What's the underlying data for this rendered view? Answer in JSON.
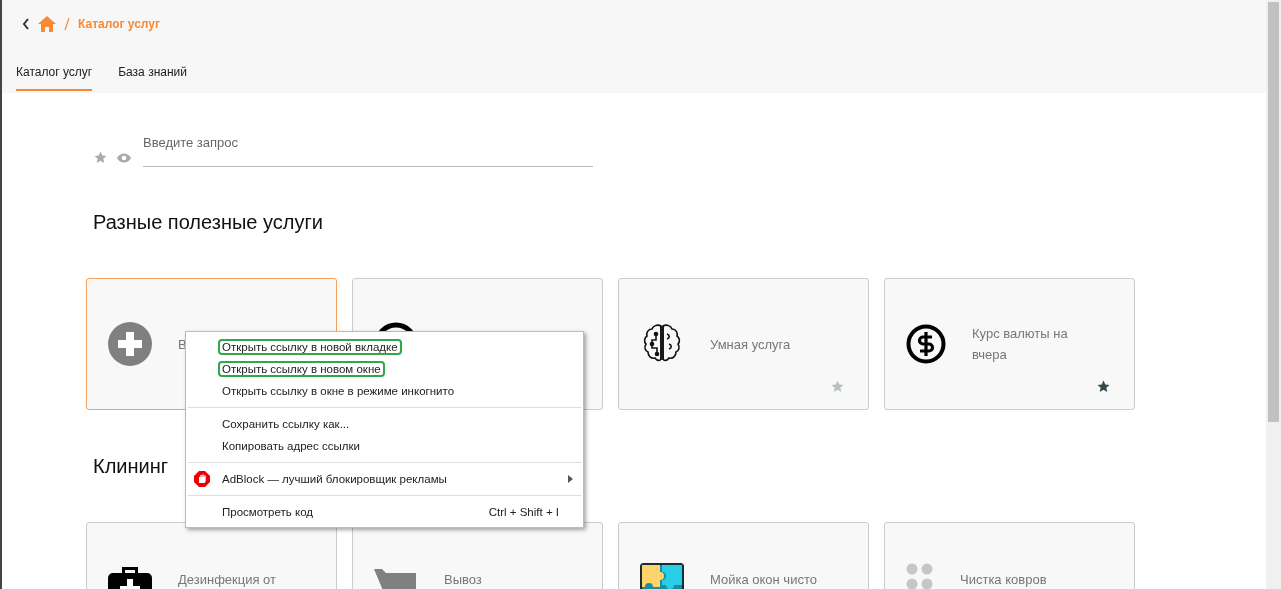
{
  "breadcrumb": {
    "current": "Каталог услуг"
  },
  "tabs": [
    {
      "label": "Каталог услуг",
      "selected": true
    },
    {
      "label": "База знаний",
      "selected": false
    }
  ],
  "search": {
    "placeholder": "Введите запрос",
    "favorites_only": false,
    "visible_only": false
  },
  "sections": [
    {
      "title": "Разные полезные услуги",
      "cards": [
        {
          "title": "В",
          "selected": true
        },
        {
          "selected": false
        },
        {
          "title": "Умная услуга",
          "selected": false,
          "favorite": false
        },
        {
          "title": "Курс валюты на вчера",
          "selected": false,
          "favorite": true
        }
      ]
    },
    {
      "title": "Клининг",
      "cards": [
        {
          "title": "Дезинфекция от",
          "selected": false
        },
        {
          "title": "Вывоз",
          "selected": false
        },
        {
          "title": "Мойка окон чисто",
          "selected": false
        },
        {
          "title": "Чистка ковров",
          "selected": false
        }
      ]
    }
  ],
  "context_menu": {
    "groups": [
      [
        {
          "label": "Открыть ссылку в новой вкладке",
          "highlighted": true
        },
        {
          "label": "Открыть ссылку в новом окне",
          "highlighted": true
        },
        {
          "label": "Открыть ссылку в окне в режиме инкогнито",
          "highlighted": false
        }
      ],
      [
        {
          "label": "Сохранить ссылку как...",
          "highlighted": false
        },
        {
          "label": "Копировать адрес ссылки",
          "highlighted": false
        }
      ],
      [
        {
          "label": "AdBlock — лучший блокировщик рекламы",
          "highlighted": false,
          "kind": "submenu"
        }
      ],
      [
        {
          "label": "Просмотреть код",
          "highlighted": false,
          "shortcut": "Ctrl + Shift + I"
        }
      ]
    ]
  }
}
